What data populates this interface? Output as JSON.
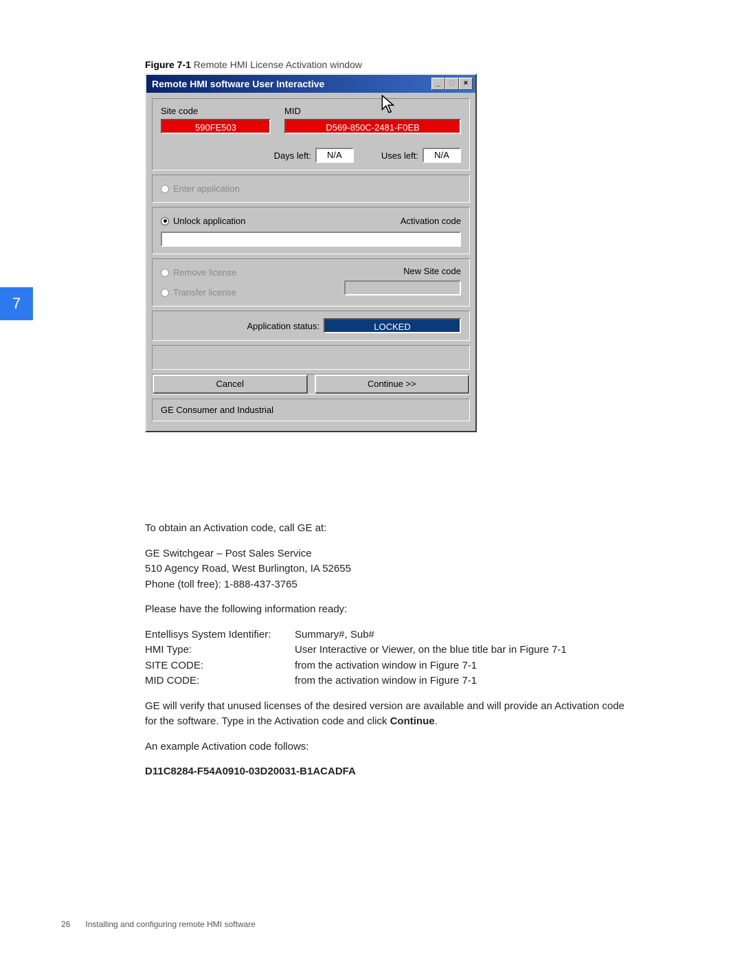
{
  "page_tab_number": "7",
  "figure_caption_label": "Figure 7-1",
  "figure_caption_text": "Remote HMI License Activation window",
  "window": {
    "title": "Remote HMI software User Interactive",
    "site_code_label": "Site code",
    "site_code_value": "590FE503",
    "mid_label": "MID",
    "mid_value": "D569-850C-2481-F0EB",
    "days_left_label": "Days left:",
    "days_left_value": "N/A",
    "uses_left_label": "Uses left:",
    "uses_left_value": "N/A",
    "enter_app_label": "Enter application",
    "unlock_app_label": "Unlock application",
    "activation_code_label": "Activation code",
    "remove_license_label": "Remove license",
    "transfer_license_label": "Transfer license",
    "new_site_code_label": "New Site code",
    "app_status_label": "Application status:",
    "app_status_value": "LOCKED",
    "cancel_label": "Cancel",
    "continue_label": "Continue >>",
    "footer_text": "GE Consumer and Industrial"
  },
  "body": {
    "p1": "To obtain an Activation code, call GE at:",
    "addr1": "GE Switchgear – Post Sales Service",
    "addr2": "510 Agency Road, West Burlington, IA 52655",
    "addr3": "Phone (toll free): 1-888-437-3765",
    "p2": "Please have the following information ready:",
    "table": [
      {
        "label": "Entellisys System Identifier:",
        "value": "Summary#, Sub#"
      },
      {
        "label": "HMI Type:",
        "value": "User Interactive or Viewer, on the blue title bar in Figure 7-1"
      },
      {
        "label": "SITE CODE:",
        "value": "from the activation window in Figure 7-1"
      },
      {
        "label": "MID CODE:",
        "value": "from the activation window in Figure 7-1"
      }
    ],
    "p3a": "GE will verify that unused licenses of the desired version are available and will provide an Activation code for the software. Type in the Activation code and click ",
    "p3b": "Continue",
    "p3c": ".",
    "p4": "An example Activation code follows:",
    "example_code": "D11C8284-F54A0910-03D20031-B1ACADFA"
  },
  "footer": {
    "page_num": "26",
    "doc_title": "Installing and configuring remote HMI software"
  }
}
